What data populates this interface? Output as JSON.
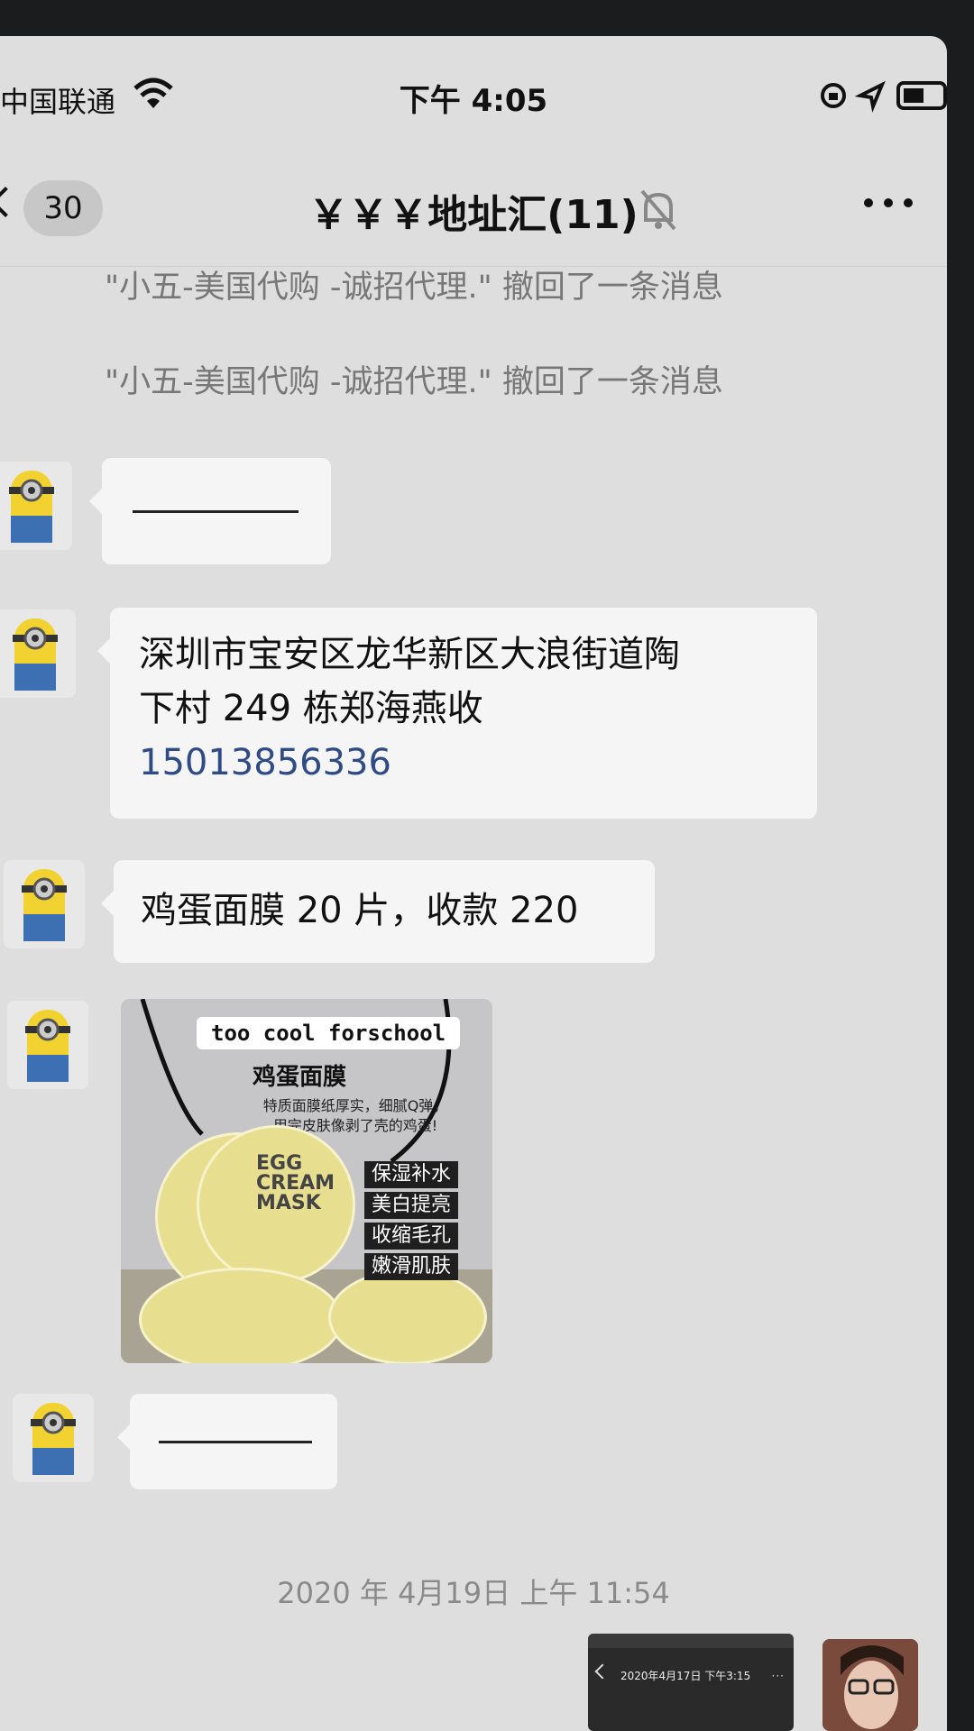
{
  "status_bar": {
    "carrier": "中国联通",
    "time": "下午 4:05"
  },
  "nav": {
    "unread_count": "30",
    "title": "￥￥￥地址汇(11)"
  },
  "messages": {
    "recall_1": "\"小五-美国代购 -诚招代理.\" 撤回了一条消息",
    "recall_2": "\"小五-美国代购 -诚招代理.\" 撤回了一条消息",
    "address_line1": "深圳市宝安区龙华新区大浪街道陶",
    "address_line2": "下村 249 栋郑海燕收",
    "address_phone": "15013856336",
    "order": "鸡蛋面膜 20 片，收款 220"
  },
  "product_image": {
    "brand": "too cool forschool",
    "title": "鸡蛋面膜",
    "desc_line1": "特质面膜纸厚实，细腻Q弹，",
    "desc_line2": "用完皮肤像剥了壳的鸡蛋!",
    "tags": [
      "保湿补水",
      "美白提亮",
      "收缩毛孔",
      "嫩滑肌肤"
    ],
    "mask_label": "EGG CREAM MASK"
  },
  "timestamp": "2020 年 4月19日 上午 11:54",
  "screenshot_preview": {
    "date": "2020年4月17日 下午3:15"
  }
}
